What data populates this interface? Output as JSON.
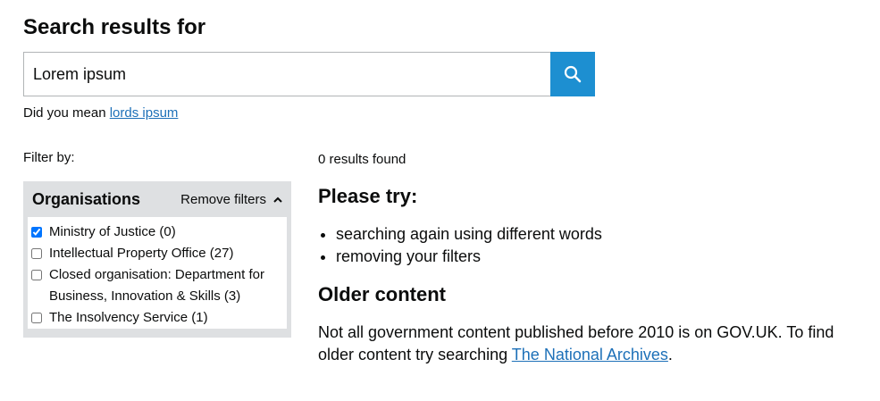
{
  "page": {
    "title": "Search results for"
  },
  "search": {
    "value": "Lorem ipsum",
    "button_icon": "search-icon",
    "button_color": "#1d8fd1"
  },
  "suggestion": {
    "prefix": "Did you mean ",
    "link": "lords ipsum"
  },
  "filters": {
    "label": "Filter by:",
    "facet": {
      "title": "Organisations",
      "remove_label": "Remove filters",
      "toggle_icon": "chevron-up-icon",
      "options": [
        {
          "label": "Ministry of Justice (0)",
          "checked": true
        },
        {
          "label": "Intellectual Property Office (27)",
          "checked": false
        },
        {
          "label": "Closed organisation: Department for Business, Innovation & Skills (3)",
          "checked": false
        },
        {
          "label": "The Insolvency Service (1)",
          "checked": false
        }
      ]
    }
  },
  "results": {
    "count_text": "0 results found",
    "please_try_title": "Please try:",
    "tips": [
      "searching again using different words",
      "removing your filters"
    ],
    "older_title": "Older content",
    "older_text_prefix": "Not all government content published before 2010 is on GOV.UK. To find older content try searching ",
    "older_link": "The National Archives",
    "older_text_suffix": "."
  },
  "colors": {
    "link": "#1d70b8",
    "facet_bg": "#dee0e2",
    "text": "#0b0c0c"
  }
}
